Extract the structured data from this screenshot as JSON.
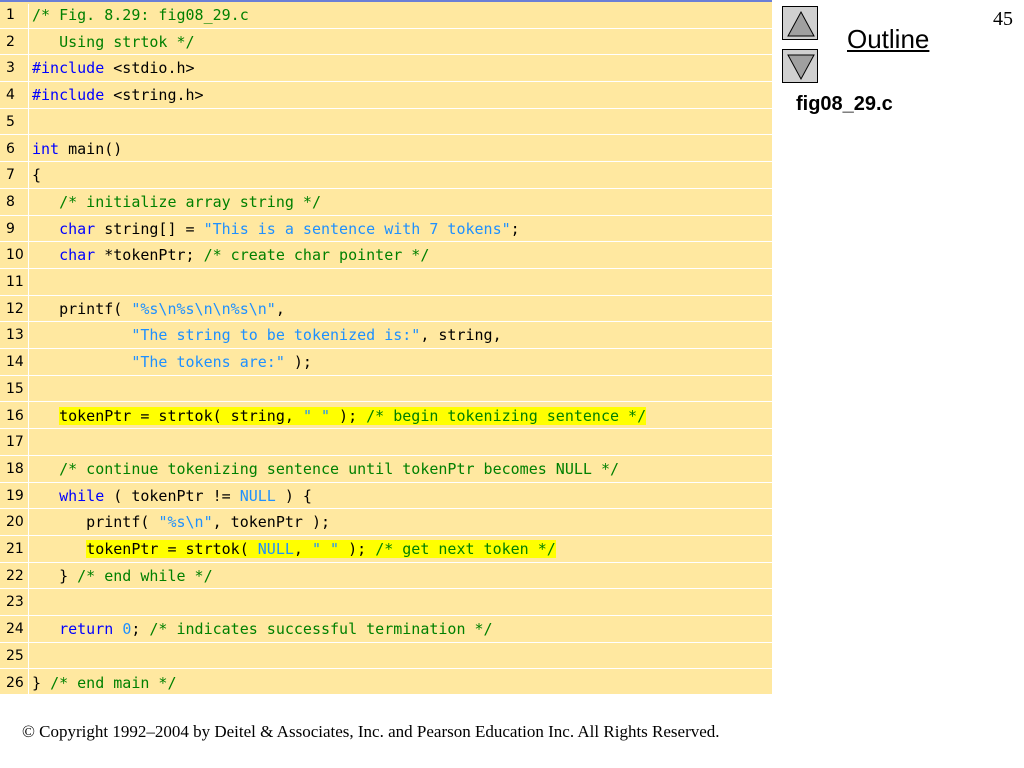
{
  "slide": {
    "page_number": "45",
    "outline_label": "Outline",
    "file_name": "fig08_29.c",
    "copyright": "© Copyright 1992–2004 by Deitel & Associates, Inc. and Pearson Education Inc. All Rights Reserved."
  },
  "nav": {
    "up_icon": "up-arrow-icon",
    "down_icon": "down-arrow-icon"
  },
  "colors": {
    "panel": "#ffe8a0",
    "keyword": "#0000ff",
    "comment": "#008000",
    "string": "#1e90ff",
    "highlight": "#ffff00"
  },
  "code": [
    {
      "num": "1",
      "tokens": [
        {
          "t": "/* Fig. 8.29: fig08_29.c",
          "c": "cm"
        }
      ]
    },
    {
      "num": "2",
      "tokens": [
        {
          "t": "   Using strtok */",
          "c": "cm"
        }
      ]
    },
    {
      "num": "3",
      "tokens": [
        {
          "t": "#include",
          "c": "pp"
        },
        {
          "t": " <stdio.h>",
          "c": ""
        }
      ]
    },
    {
      "num": "4",
      "tokens": [
        {
          "t": "#include",
          "c": "pp"
        },
        {
          "t": " <string.h>",
          "c": ""
        }
      ]
    },
    {
      "num": "5",
      "tokens": []
    },
    {
      "num": "6",
      "tokens": [
        {
          "t": "int",
          "c": "kw"
        },
        {
          "t": " main()",
          "c": ""
        }
      ]
    },
    {
      "num": "7",
      "tokens": [
        {
          "t": "{",
          "c": ""
        }
      ]
    },
    {
      "num": "8",
      "tokens": [
        {
          "t": "   ",
          "c": ""
        },
        {
          "t": "/* initialize array string */",
          "c": "cm"
        }
      ]
    },
    {
      "num": "9",
      "tokens": [
        {
          "t": "   ",
          "c": ""
        },
        {
          "t": "char",
          "c": "kw"
        },
        {
          "t": " string[] = ",
          "c": ""
        },
        {
          "t": "\"This is a sentence with 7 tokens\"",
          "c": "st"
        },
        {
          "t": ";",
          "c": ""
        }
      ]
    },
    {
      "num": "10",
      "tokens": [
        {
          "t": "   ",
          "c": ""
        },
        {
          "t": "char",
          "c": "kw"
        },
        {
          "t": " *tokenPtr; ",
          "c": ""
        },
        {
          "t": "/* create char pointer */",
          "c": "cm"
        }
      ]
    },
    {
      "num": "11",
      "tokens": []
    },
    {
      "num": "12",
      "tokens": [
        {
          "t": "   printf( ",
          "c": ""
        },
        {
          "t": "\"%s\\n%s\\n\\n%s\\n\"",
          "c": "st"
        },
        {
          "t": ",",
          "c": ""
        }
      ]
    },
    {
      "num": "13",
      "tokens": [
        {
          "t": "           ",
          "c": ""
        },
        {
          "t": "\"The string to be tokenized is:\"",
          "c": "st"
        },
        {
          "t": ", string,",
          "c": ""
        }
      ]
    },
    {
      "num": "14",
      "tokens": [
        {
          "t": "           ",
          "c": ""
        },
        {
          "t": "\"The tokens are:\"",
          "c": "st"
        },
        {
          "t": " );",
          "c": ""
        }
      ]
    },
    {
      "num": "15",
      "tokens": []
    },
    {
      "num": "16",
      "tokens": [
        {
          "t": "   ",
          "c": ""
        },
        {
          "t": "tokenPtr = strtok( string, ",
          "c": "hl"
        },
        {
          "t": "\" \"",
          "c": "st hl"
        },
        {
          "t": " ); ",
          "c": "hl"
        },
        {
          "t": "/* begin tokenizing sentence */",
          "c": "cm hl"
        }
      ]
    },
    {
      "num": "17",
      "tokens": []
    },
    {
      "num": "18",
      "tokens": [
        {
          "t": "   ",
          "c": ""
        },
        {
          "t": "/* continue tokenizing sentence until tokenPtr becomes NULL */",
          "c": "cm"
        }
      ]
    },
    {
      "num": "19",
      "tokens": [
        {
          "t": "   ",
          "c": ""
        },
        {
          "t": "while",
          "c": "kw"
        },
        {
          "t": " ( tokenPtr != ",
          "c": ""
        },
        {
          "t": "NULL",
          "c": "nu"
        },
        {
          "t": " ) {",
          "c": ""
        }
      ]
    },
    {
      "num": "20",
      "tokens": [
        {
          "t": "      printf( ",
          "c": ""
        },
        {
          "t": "\"%s\\n\"",
          "c": "st"
        },
        {
          "t": ", tokenPtr );",
          "c": ""
        }
      ]
    },
    {
      "num": "21",
      "tokens": [
        {
          "t": "      ",
          "c": ""
        },
        {
          "t": "tokenPtr = strtok( ",
          "c": "hl"
        },
        {
          "t": "NULL",
          "c": "nu hl"
        },
        {
          "t": ", ",
          "c": "hl"
        },
        {
          "t": "\" \"",
          "c": "st hl"
        },
        {
          "t": " ); ",
          "c": "hl"
        },
        {
          "t": "/* get next token */",
          "c": "cm hl"
        }
      ]
    },
    {
      "num": "22",
      "tokens": [
        {
          "t": "   } ",
          "c": ""
        },
        {
          "t": "/* end while */",
          "c": "cm"
        }
      ]
    },
    {
      "num": "23",
      "tokens": []
    },
    {
      "num": "24",
      "tokens": [
        {
          "t": "   ",
          "c": ""
        },
        {
          "t": "return",
          "c": "kw"
        },
        {
          "t": " ",
          "c": ""
        },
        {
          "t": "0",
          "c": "nu"
        },
        {
          "t": "; ",
          "c": ""
        },
        {
          "t": "/* indicates successful termination */",
          "c": "cm"
        }
      ]
    },
    {
      "num": "25",
      "tokens": []
    },
    {
      "num": "26",
      "tokens": [
        {
          "t": "} ",
          "c": ""
        },
        {
          "t": "/* end main */",
          "c": "cm"
        }
      ]
    }
  ]
}
